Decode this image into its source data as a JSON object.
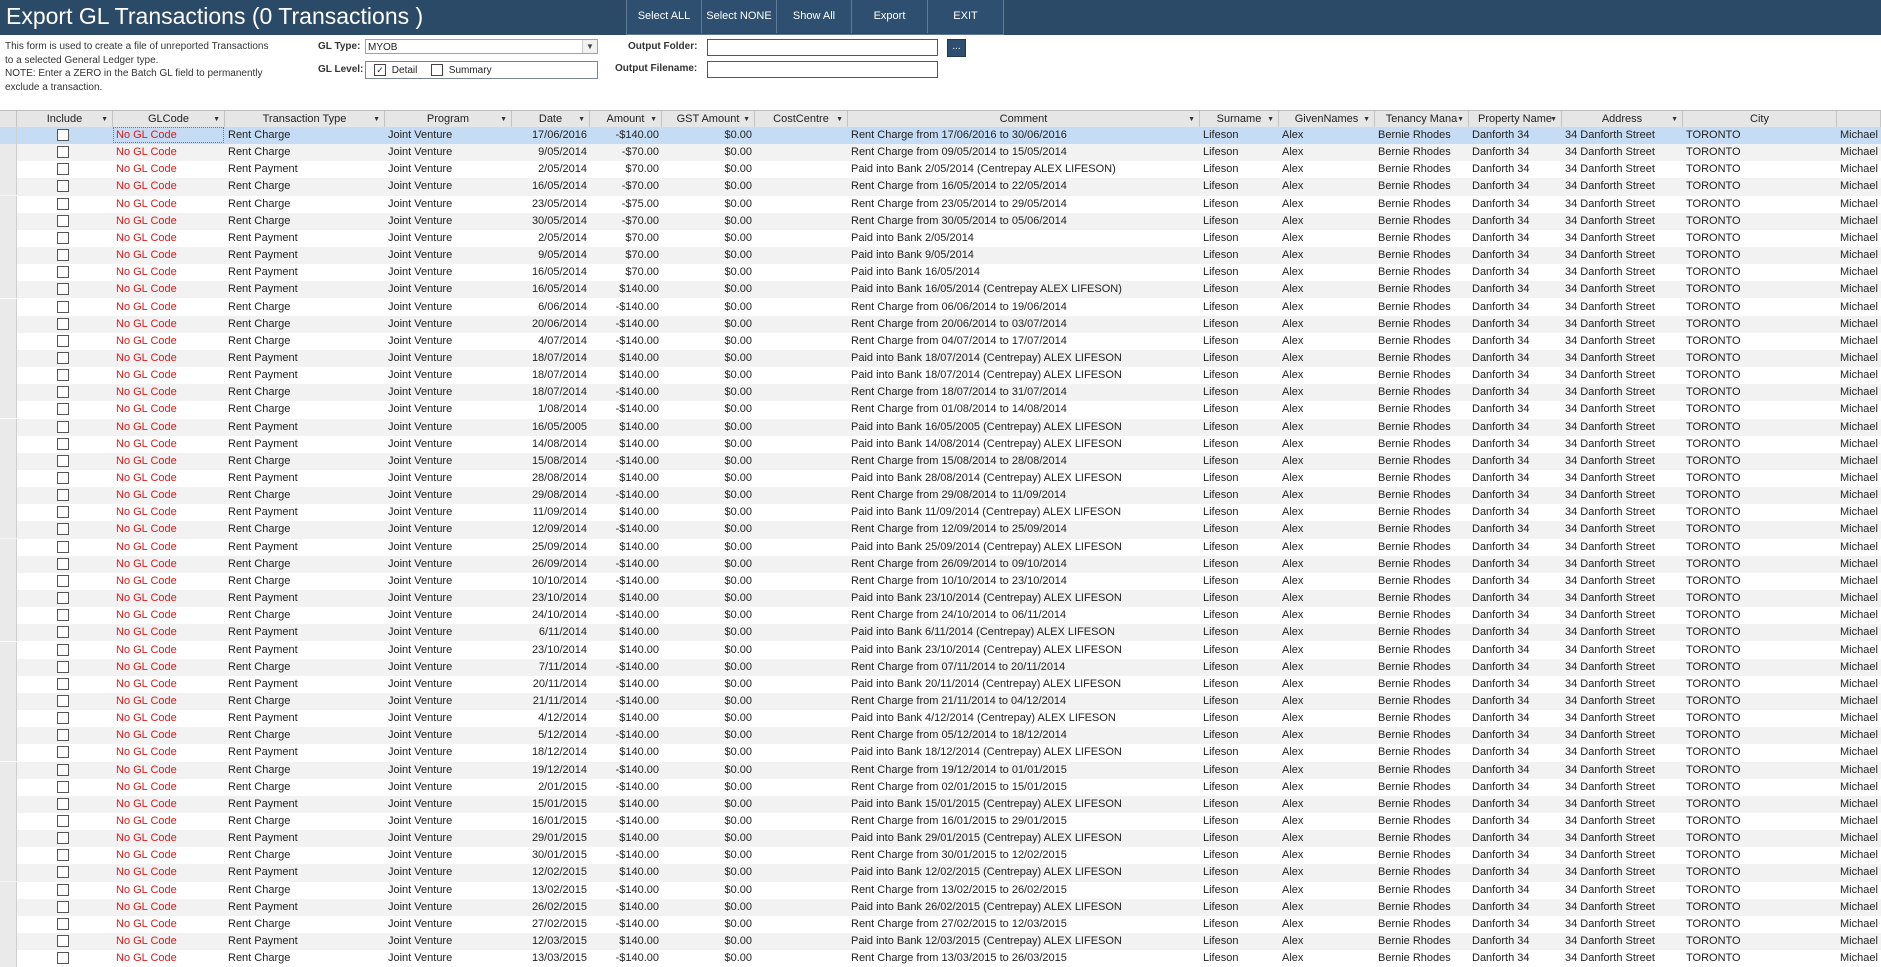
{
  "window": {
    "title": "Export GL Transactions (0 Transactions )"
  },
  "toolbar": {
    "select_all": "Select ALL",
    "select_none": "Select NONE",
    "show_all": "Show All",
    "export": "Export",
    "exit": "EXIT"
  },
  "form": {
    "description_lines": [
      "This form is used to create a file of unreported Transactions",
      "to a selected General Ledger type.",
      "NOTE: Enter a ZERO in the Batch GL field to permanently",
      "exclude a transaction."
    ],
    "gl_type_label": "GL Type:",
    "gl_type_value": "MYOB",
    "gl_level_label": "GL Level:",
    "gl_level_detail": "Detail",
    "gl_level_detail_checked": true,
    "gl_level_summary": "Summary",
    "gl_level_summary_checked": false,
    "output_folder_label": "Output Folder:",
    "output_folder_value": "",
    "browse_label": "...",
    "output_filename_label": "Output Filename:",
    "output_filename_value": ""
  },
  "grid": {
    "columns": [
      "Include",
      "GLCode",
      "Transaction Type",
      "Program",
      "Date",
      "Amount",
      "GST Amount",
      "CostCentre",
      "Comment",
      "Surname",
      "GivenNames",
      "Tenancy Mana",
      "Property Name",
      "Address",
      "City"
    ],
    "rows": [
      [
        "No GL Code",
        "Rent Charge",
        "Joint Venture",
        "17/06/2016",
        "-$140.00",
        "$0.00",
        "Rent Charge from 17/06/2016 to 30/06/2016",
        "Lifeson",
        "Alex",
        "Bernie Rhodes",
        "Danforth 34",
        "34 Danforth Street",
        "TORONTO",
        "Michael"
      ],
      [
        "No GL Code",
        "Rent Charge",
        "Joint Venture",
        "9/05/2014",
        "-$70.00",
        "$0.00",
        "Rent Charge from 09/05/2014 to 15/05/2014",
        "Lifeson",
        "Alex",
        "Bernie Rhodes",
        "Danforth 34",
        "34 Danforth Street",
        "TORONTO",
        "Michael"
      ],
      [
        "No GL Code",
        "Rent Payment",
        "Joint Venture",
        "2/05/2014",
        "$70.00",
        "$0.00",
        "Paid into Bank 2/05/2014 (Centrepay ALEX LIFESON)",
        "Lifeson",
        "Alex",
        "Bernie Rhodes",
        "Danforth 34",
        "34 Danforth Street",
        "TORONTO",
        "Michael"
      ],
      [
        "No GL Code",
        "Rent Charge",
        "Joint Venture",
        "16/05/2014",
        "-$70.00",
        "$0.00",
        "Rent Charge from 16/05/2014 to 22/05/2014",
        "Lifeson",
        "Alex",
        "Bernie Rhodes",
        "Danforth 34",
        "34 Danforth Street",
        "TORONTO",
        "Michael"
      ],
      [
        "No GL Code",
        "Rent Charge",
        "Joint Venture",
        "23/05/2014",
        "-$75.00",
        "$0.00",
        "Rent Charge from 23/05/2014 to 29/05/2014",
        "Lifeson",
        "Alex",
        "Bernie Rhodes",
        "Danforth 34",
        "34 Danforth Street",
        "TORONTO",
        "Michael"
      ],
      [
        "No GL Code",
        "Rent Charge",
        "Joint Venture",
        "30/05/2014",
        "-$70.00",
        "$0.00",
        "Rent Charge from 30/05/2014 to 05/06/2014",
        "Lifeson",
        "Alex",
        "Bernie Rhodes",
        "Danforth 34",
        "34 Danforth Street",
        "TORONTO",
        "Michael"
      ],
      [
        "No GL Code",
        "Rent Payment",
        "Joint Venture",
        "2/05/2014",
        "$70.00",
        "$0.00",
        "Paid into Bank 2/05/2014",
        "Lifeson",
        "Alex",
        "Bernie Rhodes",
        "Danforth 34",
        "34 Danforth Street",
        "TORONTO",
        "Michael"
      ],
      [
        "No GL Code",
        "Rent Payment",
        "Joint Venture",
        "9/05/2014",
        "$70.00",
        "$0.00",
        "Paid into Bank 9/05/2014",
        "Lifeson",
        "Alex",
        "Bernie Rhodes",
        "Danforth 34",
        "34 Danforth Street",
        "TORONTO",
        "Michael"
      ],
      [
        "No GL Code",
        "Rent Payment",
        "Joint Venture",
        "16/05/2014",
        "$70.00",
        "$0.00",
        "Paid into Bank 16/05/2014",
        "Lifeson",
        "Alex",
        "Bernie Rhodes",
        "Danforth 34",
        "34 Danforth Street",
        "TORONTO",
        "Michael"
      ],
      [
        "No GL Code",
        "Rent Payment",
        "Joint Venture",
        "16/05/2014",
        "$140.00",
        "$0.00",
        "Paid into Bank 16/05/2014 (Centrepay ALEX LIFESON)",
        "Lifeson",
        "Alex",
        "Bernie Rhodes",
        "Danforth 34",
        "34 Danforth Street",
        "TORONTO",
        "Michael"
      ],
      [
        "No GL Code",
        "Rent Charge",
        "Joint Venture",
        "6/06/2014",
        "-$140.00",
        "$0.00",
        "Rent Charge from 06/06/2014 to 19/06/2014",
        "Lifeson",
        "Alex",
        "Bernie Rhodes",
        "Danforth 34",
        "34 Danforth Street",
        "TORONTO",
        "Michael"
      ],
      [
        "No GL Code",
        "Rent Charge",
        "Joint Venture",
        "20/06/2014",
        "-$140.00",
        "$0.00",
        "Rent Charge from 20/06/2014 to 03/07/2014",
        "Lifeson",
        "Alex",
        "Bernie Rhodes",
        "Danforth 34",
        "34 Danforth Street",
        "TORONTO",
        "Michael"
      ],
      [
        "No GL Code",
        "Rent Charge",
        "Joint Venture",
        "4/07/2014",
        "-$140.00",
        "$0.00",
        "Rent Charge from 04/07/2014 to 17/07/2014",
        "Lifeson",
        "Alex",
        "Bernie Rhodes",
        "Danforth 34",
        "34 Danforth Street",
        "TORONTO",
        "Michael"
      ],
      [
        "No GL Code",
        "Rent Payment",
        "Joint Venture",
        "18/07/2014",
        "$140.00",
        "$0.00",
        "Paid into Bank 18/07/2014 (Centrepay) ALEX LIFESON",
        "Lifeson",
        "Alex",
        "Bernie Rhodes",
        "Danforth 34",
        "34 Danforth Street",
        "TORONTO",
        "Michael"
      ],
      [
        "No GL Code",
        "Rent Payment",
        "Joint Venture",
        "18/07/2014",
        "$140.00",
        "$0.00",
        "Paid into Bank 18/07/2014 (Centrepay) ALEX LIFESON",
        "Lifeson",
        "Alex",
        "Bernie Rhodes",
        "Danforth 34",
        "34 Danforth Street",
        "TORONTO",
        "Michael"
      ],
      [
        "No GL Code",
        "Rent Charge",
        "Joint Venture",
        "18/07/2014",
        "-$140.00",
        "$0.00",
        "Rent Charge from 18/07/2014 to 31/07/2014",
        "Lifeson",
        "Alex",
        "Bernie Rhodes",
        "Danforth 34",
        "34 Danforth Street",
        "TORONTO",
        "Michael"
      ],
      [
        "No GL Code",
        "Rent Charge",
        "Joint Venture",
        "1/08/2014",
        "-$140.00",
        "$0.00",
        "Rent Charge from 01/08/2014 to 14/08/2014",
        "Lifeson",
        "Alex",
        "Bernie Rhodes",
        "Danforth 34",
        "34 Danforth Street",
        "TORONTO",
        "Michael"
      ],
      [
        "No GL Code",
        "Rent Payment",
        "Joint Venture",
        "16/05/2005",
        "$140.00",
        "$0.00",
        "Paid into Bank 16/05/2005 (Centrepay) ALEX LIFESON",
        "Lifeson",
        "Alex",
        "Bernie Rhodes",
        "Danforth 34",
        "34 Danforth Street",
        "TORONTO",
        "Michael"
      ],
      [
        "No GL Code",
        "Rent Payment",
        "Joint Venture",
        "14/08/2014",
        "$140.00",
        "$0.00",
        "Paid into Bank 14/08/2014 (Centrepay) ALEX LIFESON",
        "Lifeson",
        "Alex",
        "Bernie Rhodes",
        "Danforth 34",
        "34 Danforth Street",
        "TORONTO",
        "Michael"
      ],
      [
        "No GL Code",
        "Rent Charge",
        "Joint Venture",
        "15/08/2014",
        "-$140.00",
        "$0.00",
        "Rent Charge from 15/08/2014 to 28/08/2014",
        "Lifeson",
        "Alex",
        "Bernie Rhodes",
        "Danforth 34",
        "34 Danforth Street",
        "TORONTO",
        "Michael"
      ],
      [
        "No GL Code",
        "Rent Payment",
        "Joint Venture",
        "28/08/2014",
        "$140.00",
        "$0.00",
        "Paid into Bank 28/08/2014 (Centrepay) ALEX LIFESON",
        "Lifeson",
        "Alex",
        "Bernie Rhodes",
        "Danforth 34",
        "34 Danforth Street",
        "TORONTO",
        "Michael"
      ],
      [
        "No GL Code",
        "Rent Charge",
        "Joint Venture",
        "29/08/2014",
        "-$140.00",
        "$0.00",
        "Rent Charge from 29/08/2014 to 11/09/2014",
        "Lifeson",
        "Alex",
        "Bernie Rhodes",
        "Danforth 34",
        "34 Danforth Street",
        "TORONTO",
        "Michael"
      ],
      [
        "No GL Code",
        "Rent Payment",
        "Joint Venture",
        "11/09/2014",
        "$140.00",
        "$0.00",
        "Paid into Bank 11/09/2014 (Centrepay) ALEX LIFESON",
        "Lifeson",
        "Alex",
        "Bernie Rhodes",
        "Danforth 34",
        "34 Danforth Street",
        "TORONTO",
        "Michael"
      ],
      [
        "No GL Code",
        "Rent Charge",
        "Joint Venture",
        "12/09/2014",
        "-$140.00",
        "$0.00",
        "Rent Charge from 12/09/2014 to 25/09/2014",
        "Lifeson",
        "Alex",
        "Bernie Rhodes",
        "Danforth 34",
        "34 Danforth Street",
        "TORONTO",
        "Michael"
      ],
      [
        "No GL Code",
        "Rent Payment",
        "Joint Venture",
        "25/09/2014",
        "$140.00",
        "$0.00",
        "Paid into Bank 25/09/2014 (Centrepay) ALEX LIFESON",
        "Lifeson",
        "Alex",
        "Bernie Rhodes",
        "Danforth 34",
        "34 Danforth Street",
        "TORONTO",
        "Michael"
      ],
      [
        "No GL Code",
        "Rent Charge",
        "Joint Venture",
        "26/09/2014",
        "-$140.00",
        "$0.00",
        "Rent Charge from 26/09/2014 to 09/10/2014",
        "Lifeson",
        "Alex",
        "Bernie Rhodes",
        "Danforth 34",
        "34 Danforth Street",
        "TORONTO",
        "Michael"
      ],
      [
        "No GL Code",
        "Rent Charge",
        "Joint Venture",
        "10/10/2014",
        "-$140.00",
        "$0.00",
        "Rent Charge from 10/10/2014 to 23/10/2014",
        "Lifeson",
        "Alex",
        "Bernie Rhodes",
        "Danforth 34",
        "34 Danforth Street",
        "TORONTO",
        "Michael"
      ],
      [
        "No GL Code",
        "Rent Payment",
        "Joint Venture",
        "23/10/2014",
        "$140.00",
        "$0.00",
        "Paid into Bank 23/10/2014 (Centrepay) ALEX LIFESON",
        "Lifeson",
        "Alex",
        "Bernie Rhodes",
        "Danforth 34",
        "34 Danforth Street",
        "TORONTO",
        "Michael"
      ],
      [
        "No GL Code",
        "Rent Charge",
        "Joint Venture",
        "24/10/2014",
        "-$140.00",
        "$0.00",
        "Rent Charge from 24/10/2014 to 06/11/2014",
        "Lifeson",
        "Alex",
        "Bernie Rhodes",
        "Danforth 34",
        "34 Danforth Street",
        "TORONTO",
        "Michael"
      ],
      [
        "No GL Code",
        "Rent Payment",
        "Joint Venture",
        "6/11/2014",
        "$140.00",
        "$0.00",
        "Paid into Bank 6/11/2014 (Centrepay) ALEX LIFESON",
        "Lifeson",
        "Alex",
        "Bernie Rhodes",
        "Danforth 34",
        "34 Danforth Street",
        "TORONTO",
        "Michael"
      ],
      [
        "No GL Code",
        "Rent Payment",
        "Joint Venture",
        "23/10/2014",
        "$140.00",
        "$0.00",
        "Paid into Bank 23/10/2014 (Centrepay) ALEX LIFESON",
        "Lifeson",
        "Alex",
        "Bernie Rhodes",
        "Danforth 34",
        "34 Danforth Street",
        "TORONTO",
        "Michael"
      ],
      [
        "No GL Code",
        "Rent Charge",
        "Joint Venture",
        "7/11/2014",
        "-$140.00",
        "$0.00",
        "Rent Charge from 07/11/2014 to 20/11/2014",
        "Lifeson",
        "Alex",
        "Bernie Rhodes",
        "Danforth 34",
        "34 Danforth Street",
        "TORONTO",
        "Michael"
      ],
      [
        "No GL Code",
        "Rent Payment",
        "Joint Venture",
        "20/11/2014",
        "$140.00",
        "$0.00",
        "Paid into Bank 20/11/2014 (Centrepay) ALEX LIFESON",
        "Lifeson",
        "Alex",
        "Bernie Rhodes",
        "Danforth 34",
        "34 Danforth Street",
        "TORONTO",
        "Michael"
      ],
      [
        "No GL Code",
        "Rent Charge",
        "Joint Venture",
        "21/11/2014",
        "-$140.00",
        "$0.00",
        "Rent Charge from 21/11/2014 to 04/12/2014",
        "Lifeson",
        "Alex",
        "Bernie Rhodes",
        "Danforth 34",
        "34 Danforth Street",
        "TORONTO",
        "Michael"
      ],
      [
        "No GL Code",
        "Rent Payment",
        "Joint Venture",
        "4/12/2014",
        "$140.00",
        "$0.00",
        "Paid into Bank 4/12/2014 (Centrepay) ALEX LIFESON",
        "Lifeson",
        "Alex",
        "Bernie Rhodes",
        "Danforth 34",
        "34 Danforth Street",
        "TORONTO",
        "Michael"
      ],
      [
        "No GL Code",
        "Rent Charge",
        "Joint Venture",
        "5/12/2014",
        "-$140.00",
        "$0.00",
        "Rent Charge from 05/12/2014 to 18/12/2014",
        "Lifeson",
        "Alex",
        "Bernie Rhodes",
        "Danforth 34",
        "34 Danforth Street",
        "TORONTO",
        "Michael"
      ],
      [
        "No GL Code",
        "Rent Payment",
        "Joint Venture",
        "18/12/2014",
        "$140.00",
        "$0.00",
        "Paid into Bank 18/12/2014 (Centrepay) ALEX LIFESON",
        "Lifeson",
        "Alex",
        "Bernie Rhodes",
        "Danforth 34",
        "34 Danforth Street",
        "TORONTO",
        "Michael"
      ],
      [
        "No GL Code",
        "Rent Charge",
        "Joint Venture",
        "19/12/2014",
        "-$140.00",
        "$0.00",
        "Rent Charge from 19/12/2014 to 01/01/2015",
        "Lifeson",
        "Alex",
        "Bernie Rhodes",
        "Danforth 34",
        "34 Danforth Street",
        "TORONTO",
        "Michael"
      ],
      [
        "No GL Code",
        "Rent Charge",
        "Joint Venture",
        "2/01/2015",
        "-$140.00",
        "$0.00",
        "Rent Charge from 02/01/2015 to 15/01/2015",
        "Lifeson",
        "Alex",
        "Bernie Rhodes",
        "Danforth 34",
        "34 Danforth Street",
        "TORONTO",
        "Michael"
      ],
      [
        "No GL Code",
        "Rent Payment",
        "Joint Venture",
        "15/01/2015",
        "$140.00",
        "$0.00",
        "Paid into Bank 15/01/2015 (Centrepay) ALEX LIFESON",
        "Lifeson",
        "Alex",
        "Bernie Rhodes",
        "Danforth 34",
        "34 Danforth Street",
        "TORONTO",
        "Michael"
      ],
      [
        "No GL Code",
        "Rent Charge",
        "Joint Venture",
        "16/01/2015",
        "-$140.00",
        "$0.00",
        "Rent Charge from 16/01/2015 to 29/01/2015",
        "Lifeson",
        "Alex",
        "Bernie Rhodes",
        "Danforth 34",
        "34 Danforth Street",
        "TORONTO",
        "Michael"
      ],
      [
        "No GL Code",
        "Rent Payment",
        "Joint Venture",
        "29/01/2015",
        "$140.00",
        "$0.00",
        "Paid into Bank 29/01/2015 (Centrepay) ALEX LIFESON",
        "Lifeson",
        "Alex",
        "Bernie Rhodes",
        "Danforth 34",
        "34 Danforth Street",
        "TORONTO",
        "Michael"
      ],
      [
        "No GL Code",
        "Rent Charge",
        "Joint Venture",
        "30/01/2015",
        "-$140.00",
        "$0.00",
        "Rent Charge from 30/01/2015 to 12/02/2015",
        "Lifeson",
        "Alex",
        "Bernie Rhodes",
        "Danforth 34",
        "34 Danforth Street",
        "TORONTO",
        "Michael"
      ],
      [
        "No GL Code",
        "Rent Payment",
        "Joint Venture",
        "12/02/2015",
        "$140.00",
        "$0.00",
        "Paid into Bank 12/02/2015 (Centrepay) ALEX LIFESON",
        "Lifeson",
        "Alex",
        "Bernie Rhodes",
        "Danforth 34",
        "34 Danforth Street",
        "TORONTO",
        "Michael"
      ],
      [
        "No GL Code",
        "Rent Charge",
        "Joint Venture",
        "13/02/2015",
        "-$140.00",
        "$0.00",
        "Rent Charge from 13/02/2015 to 26/02/2015",
        "Lifeson",
        "Alex",
        "Bernie Rhodes",
        "Danforth 34",
        "34 Danforth Street",
        "TORONTO",
        "Michael"
      ],
      [
        "No GL Code",
        "Rent Payment",
        "Joint Venture",
        "26/02/2015",
        "$140.00",
        "$0.00",
        "Paid into Bank 26/02/2015 (Centrepay) ALEX LIFESON",
        "Lifeson",
        "Alex",
        "Bernie Rhodes",
        "Danforth 34",
        "34 Danforth Street",
        "TORONTO",
        "Michael"
      ],
      [
        "No GL Code",
        "Rent Charge",
        "Joint Venture",
        "27/02/2015",
        "-$140.00",
        "$0.00",
        "Rent Charge from 27/02/2015 to 12/03/2015",
        "Lifeson",
        "Alex",
        "Bernie Rhodes",
        "Danforth 34",
        "34 Danforth Street",
        "TORONTO",
        "Michael"
      ],
      [
        "No GL Code",
        "Rent Payment",
        "Joint Venture",
        "12/03/2015",
        "$140.00",
        "$0.00",
        "Paid into Bank 12/03/2015 (Centrepay) ALEX LIFESON",
        "Lifeson",
        "Alex",
        "Bernie Rhodes",
        "Danforth 34",
        "34 Danforth Street",
        "TORONTO",
        "Michael"
      ],
      [
        "No GL Code",
        "Rent Charge",
        "Joint Venture",
        "13/03/2015",
        "-$140.00",
        "$0.00",
        "Rent Charge from 13/03/2015 to 26/03/2015",
        "Lifeson",
        "Alex",
        "Bernie Rhodes",
        "Danforth 34",
        "34 Danforth Street",
        "TORONTO",
        "Michael"
      ]
    ]
  },
  "colors": {
    "header_bg": "#2b4a68",
    "glcode_red": "#e01818",
    "selected_row": "#c5dcf4",
    "alt_row": "#f2f2f2"
  }
}
